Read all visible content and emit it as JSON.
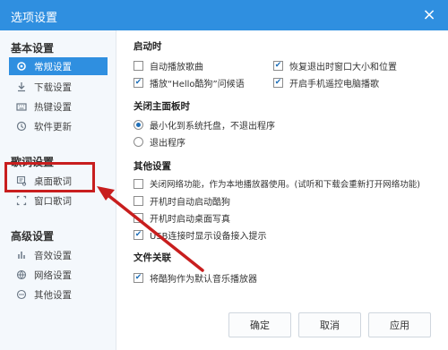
{
  "window": {
    "title": "选项设置",
    "close_glyph": "×"
  },
  "sidebar": {
    "groups": [
      {
        "title": "基本设置",
        "items": [
          {
            "label": "常规设置",
            "icon": "gear-icon",
            "active": true
          },
          {
            "label": "下载设置",
            "icon": "download-icon"
          },
          {
            "label": "热键设置",
            "icon": "keyboard-icon"
          },
          {
            "label": "软件更新",
            "icon": "update-icon"
          }
        ]
      },
      {
        "title": "歌词设置",
        "items": [
          {
            "label": "桌面歌词",
            "icon": "desktop-lyrics-icon"
          },
          {
            "label": "窗口歌词",
            "icon": "window-lyrics-icon"
          }
        ]
      },
      {
        "title": "高级设置",
        "items": [
          {
            "label": "音效设置",
            "icon": "equalizer-icon"
          },
          {
            "label": "网络设置",
            "icon": "network-icon"
          },
          {
            "label": "其他设置",
            "icon": "more-icon"
          }
        ]
      }
    ]
  },
  "sections": {
    "startup": {
      "title": "启动时",
      "options": [
        {
          "label": "自动播放歌曲",
          "checked": false
        },
        {
          "label": "恢复退出时窗口大小和位置",
          "checked": true
        },
        {
          "label": "播放“Hello酷狗”问候语",
          "checked": true
        },
        {
          "label": "开启手机遥控电脑播歌",
          "checked": true
        }
      ]
    },
    "close_panel": {
      "title": "关闭主面板时",
      "options": [
        {
          "label": "最小化到系统托盘，不退出程序",
          "selected": true
        },
        {
          "label": "退出程序",
          "selected": false
        }
      ]
    },
    "other": {
      "title": "其他设置",
      "options": [
        {
          "label": "关闭网络功能，作为本地播放器使用。(试听和下载会重新打开网络功能)",
          "checked": false
        },
        {
          "label": "开机时自动启动酷狗",
          "checked": false
        },
        {
          "label": "开机时启动桌面写真",
          "checked": false
        },
        {
          "label": "USB连接时显示设备接入提示",
          "checked": true
        }
      ]
    },
    "file_assoc": {
      "title": "文件关联",
      "options": [
        {
          "label": "将酷狗作为默认音乐播放器",
          "checked": true
        }
      ]
    }
  },
  "buttons": {
    "ok": "确定",
    "cancel": "取消",
    "apply": "应用"
  },
  "colors": {
    "accent": "#2f8fe0",
    "annotation": "#c81e1e"
  }
}
